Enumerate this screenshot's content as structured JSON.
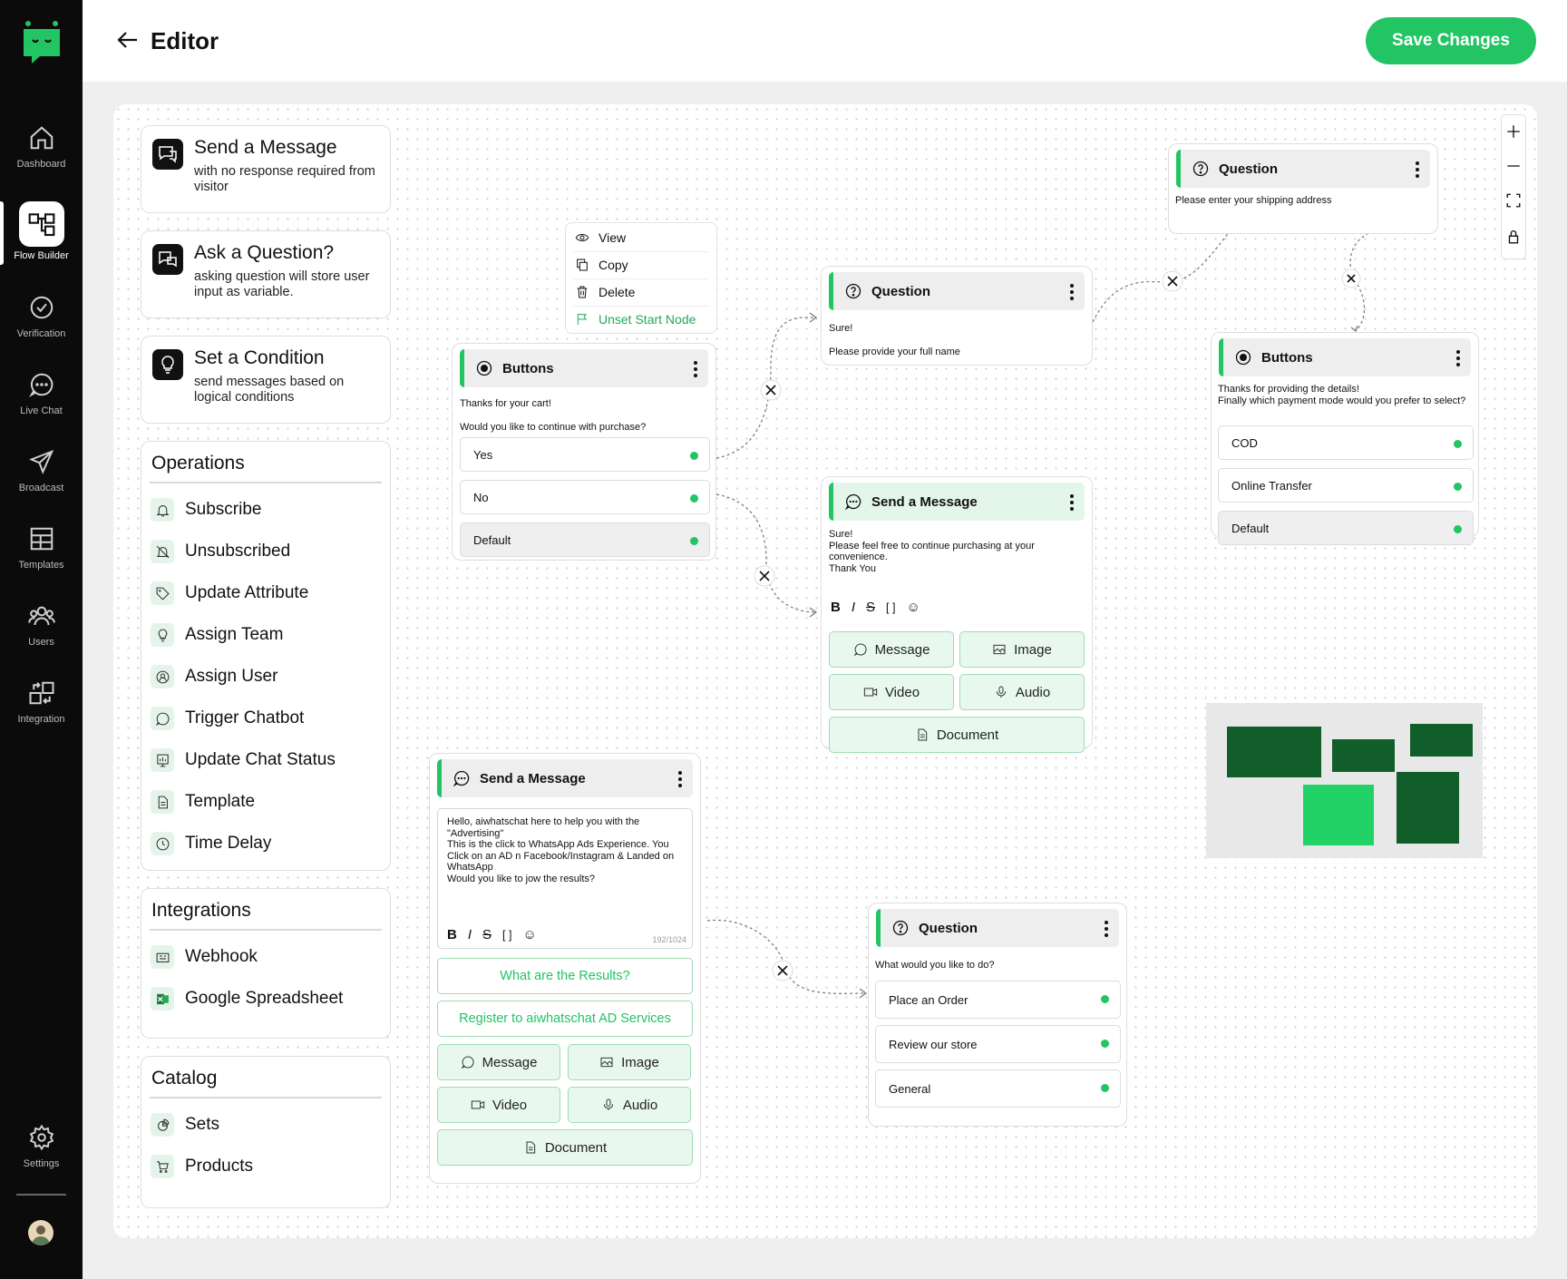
{
  "sidebar": {
    "items": [
      {
        "label": "Dashboard",
        "icon": "home-icon"
      },
      {
        "label": "Flow Builder",
        "icon": "flow-icon"
      },
      {
        "label": "Verification",
        "icon": "check-circle-icon"
      },
      {
        "label": "Live Chat",
        "icon": "chat-icon"
      },
      {
        "label": "Broadcast",
        "icon": "send-icon"
      },
      {
        "label": "Templates",
        "icon": "grid-icon"
      },
      {
        "label": "Users",
        "icon": "users-icon"
      },
      {
        "label": "Integration",
        "icon": "integration-icon"
      },
      {
        "label": "Settings",
        "icon": "gear-icon"
      }
    ]
  },
  "header": {
    "title": "Editor",
    "save_label": "Save Changes"
  },
  "palette": {
    "cards": [
      {
        "title": "Send a Message",
        "desc": "with no response required from visitor"
      },
      {
        "title": "Ask a Question?",
        "desc": "asking question will store user input as variable."
      },
      {
        "title": "Set a Condition",
        "desc": "send messages based on logical conditions"
      }
    ],
    "operations": {
      "title": "Operations",
      "items": [
        "Subscribe",
        "Unsubscribed",
        "Update Attribute",
        "Assign Team",
        "Assign User",
        "Trigger Chatbot",
        "Update Chat Status",
        "Template",
        "Time Delay"
      ]
    },
    "integrations": {
      "title": "Integrations",
      "items": [
        "Webhook",
        "Google Spreadsheet"
      ]
    },
    "catalog": {
      "title": "Catalog",
      "items": [
        "Sets",
        "Products"
      ]
    }
  },
  "context_menu": {
    "items": [
      "View",
      "Copy",
      "Delete",
      "Unset Start Node"
    ]
  },
  "nodes": {
    "buttons1": {
      "title": "Buttons",
      "line1": "Thanks for your cart!",
      "line2": "Would you like to continue with purchase?",
      "options": [
        "Yes",
        "No",
        "Default"
      ]
    },
    "question1": {
      "title": "Question",
      "line1": "Sure!",
      "line2": "Please provide your full name"
    },
    "question2": {
      "title": "Question",
      "line1": "Please enter your shipping address"
    },
    "buttons2": {
      "title": "Buttons",
      "text": "Thanks for providing the details!\nFinally which payment mode would you prefer to select?",
      "options": [
        "COD",
        "Online Transfer",
        "Default"
      ]
    },
    "message1": {
      "title": "Send a Message",
      "text": "Sure!\nPlease feel free to continue purchasing at your convenience.\nThank You",
      "buttons": [
        "Message",
        "Image",
        "Video",
        "Audio",
        "Document"
      ]
    },
    "message2": {
      "title": "Send a Message",
      "text": "Hello, aiwhatschat here to help you with the \"Advertising\"\nThis is the click to WhatsApp Ads Experience. You Click on an AD n Facebook/Instagram & Landed on WhatsApp\nWould you like to jow the results?",
      "counter": "192/1024",
      "links": [
        "What are the Results?",
        "Register to aiwhatschat AD Services"
      ],
      "buttons": [
        "Message",
        "Image",
        "Video",
        "Audio",
        "Document"
      ]
    },
    "question3": {
      "title": "Question",
      "text": "What would you like to do?",
      "options": [
        "Place an Order",
        "Review our store",
        "General"
      ]
    }
  },
  "colors": {
    "accent": "#23c464",
    "sidebar": "#0b0b0b",
    "minimap_dark": "#125e2b"
  }
}
